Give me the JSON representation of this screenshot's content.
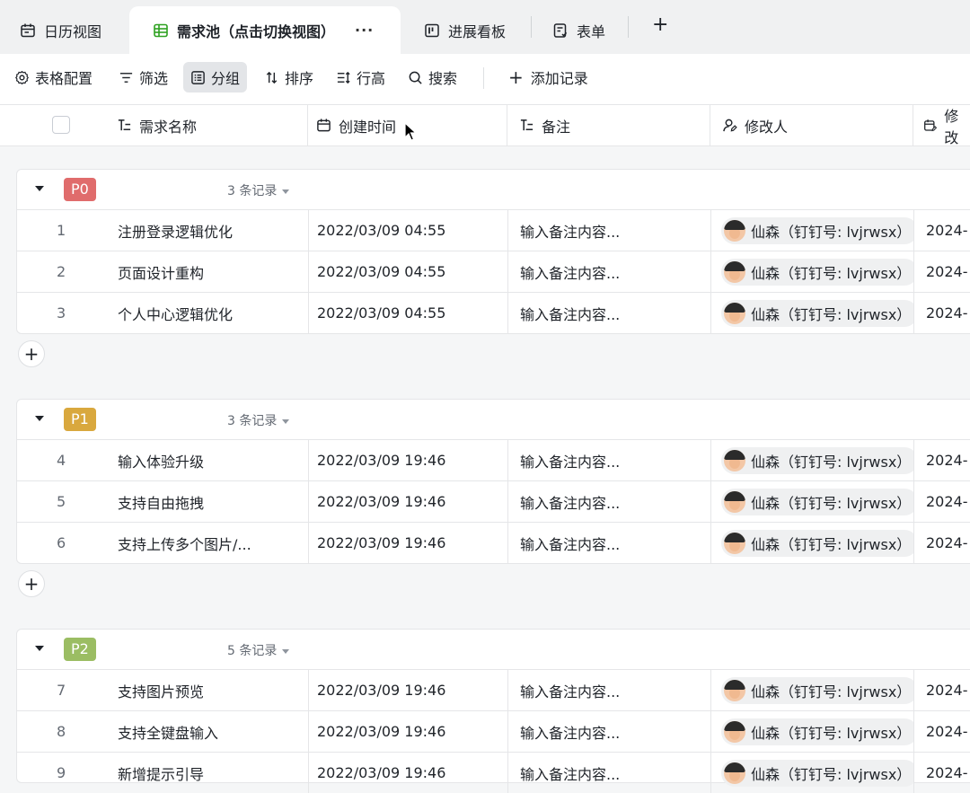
{
  "tabs": [
    {
      "label": "日历视图",
      "icon": "calendar-icon"
    },
    {
      "label": "需求池（点击切换视图）",
      "icon": "grid-table-icon",
      "more": "···"
    },
    {
      "label": "进展看板",
      "icon": "kanban-icon"
    },
    {
      "label": "表单",
      "icon": "form-icon"
    }
  ],
  "tab_add": "+",
  "toolbar": {
    "config": "表格配置",
    "filter": "筛选",
    "group": "分组",
    "sort": "排序",
    "row_height": "行高",
    "search": "搜索",
    "add_record": "添加记录",
    "add_plus": "+"
  },
  "columns": [
    "需求名称",
    "创建时间",
    "备注",
    "修改人",
    "修改"
  ],
  "groups": [
    {
      "tag": "P0",
      "tag_color": "#e06c6c",
      "count": "3 条记录",
      "rows": [
        {
          "num": "1",
          "name": "注册登录逻辑优化",
          "time": "2022/03/09 04:55",
          "note": "输入备注内容...",
          "person": "仙森（钉钉号: lvjrwsx）",
          "mod": "2024-"
        },
        {
          "num": "2",
          "name": "页面设计重构",
          "time": "2022/03/09 04:55",
          "note": "输入备注内容...",
          "person": "仙森（钉钉号: lvjrwsx）",
          "mod": "2024-"
        },
        {
          "num": "3",
          "name": "个人中心逻辑优化",
          "time": "2022/03/09 04:55",
          "note": "输入备注内容...",
          "person": "仙森（钉钉号: lvjrwsx）",
          "mod": "2024-"
        }
      ]
    },
    {
      "tag": "P1",
      "tag_color": "#d9a83e",
      "count": "3 条记录",
      "rows": [
        {
          "num": "4",
          "name": "输入体验升级",
          "time": "2022/03/09 19:46",
          "note": "输入备注内容...",
          "person": "仙森（钉钉号: lvjrwsx）",
          "mod": "2024-"
        },
        {
          "num": "5",
          "name": "支持自由拖拽",
          "time": "2022/03/09 19:46",
          "note": "输入备注内容...",
          "person": "仙森（钉钉号: lvjrwsx）",
          "mod": "2024-"
        },
        {
          "num": "6",
          "name": "支持上传多个图片/...",
          "time": "2022/03/09 19:46",
          "note": "输入备注内容...",
          "person": "仙森（钉钉号: lvjrwsx）",
          "mod": "2024-"
        }
      ]
    },
    {
      "tag": "P2",
      "tag_color": "#9bbd63",
      "count": "5 条记录",
      "rows": [
        {
          "num": "7",
          "name": "支持图片预览",
          "time": "2022/03/09 19:46",
          "note": "输入备注内容...",
          "person": "仙森（钉钉号: lvjrwsx）",
          "mod": "2024-"
        },
        {
          "num": "8",
          "name": "支持全键盘输入",
          "time": "2022/03/09 19:46",
          "note": "输入备注内容...",
          "person": "仙森（钉钉号: lvjrwsx）",
          "mod": "2024-"
        },
        {
          "num": "9",
          "name": "新增提示引导",
          "time": "2022/03/09 19:46",
          "note": "输入备注内容...",
          "person": "仙森（钉钉号: lvjrwsx）",
          "mod": "2024-"
        }
      ]
    }
  ],
  "add_row": "+"
}
